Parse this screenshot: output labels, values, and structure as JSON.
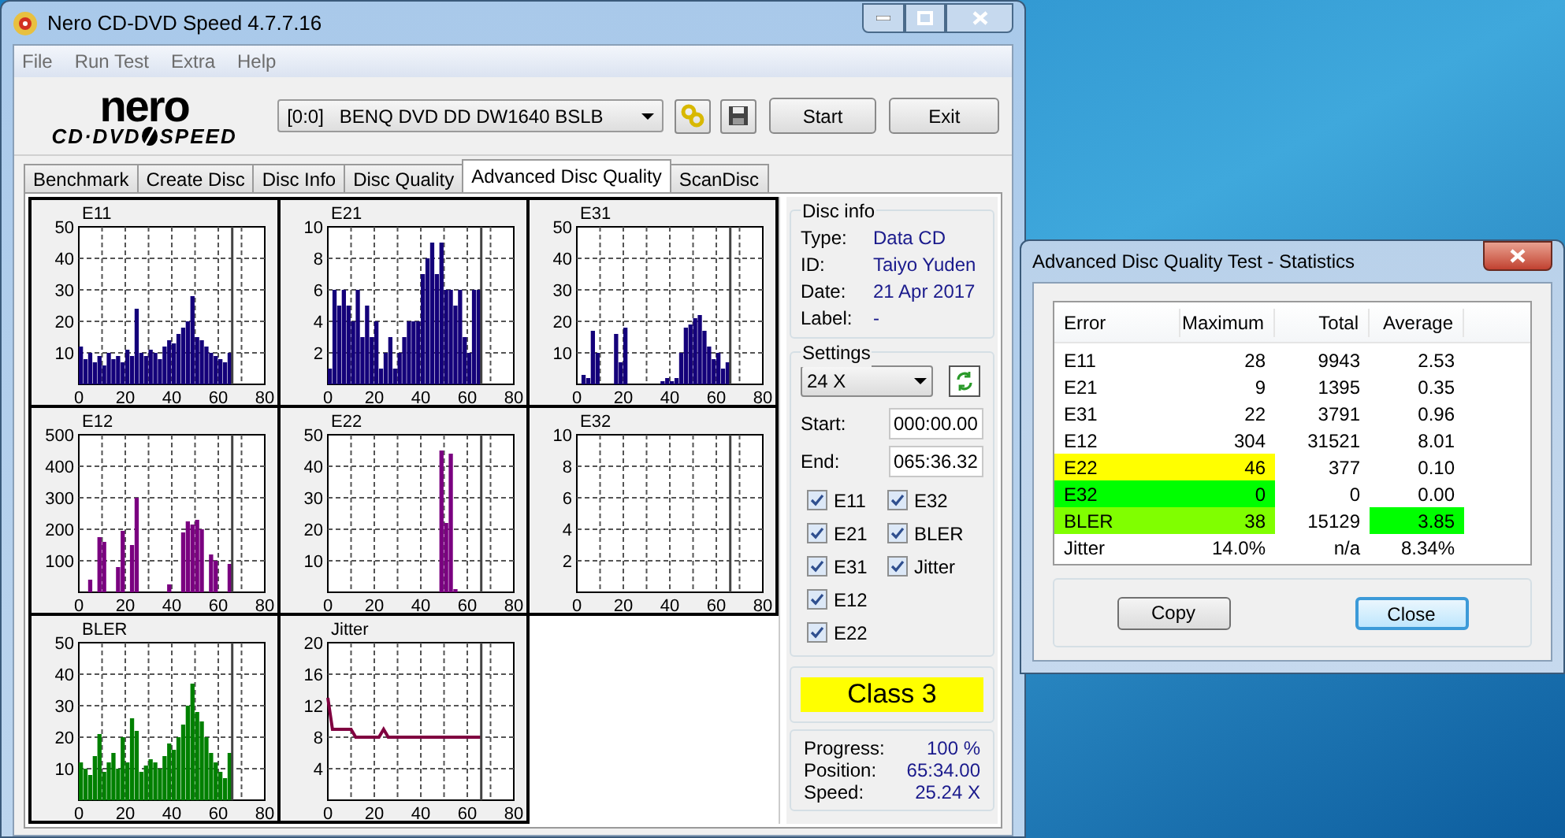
{
  "window": {
    "title": "Nero CD-DVD Speed 4.7.7.16"
  },
  "menu": [
    "File",
    "Run Test",
    "Extra",
    "Help"
  ],
  "logo": {
    "brand": "nero",
    "line_left": "CD·DVD",
    "line_right": "SPEED"
  },
  "toolbar": {
    "drive": "[0:0]   BENQ DVD DD DW1640 BSLB",
    "start": "Start",
    "exit": "Exit"
  },
  "tabs": [
    {
      "label": "Benchmark",
      "selected": false
    },
    {
      "label": "Create Disc",
      "selected": false
    },
    {
      "label": "Disc Info",
      "selected": false
    },
    {
      "label": "Disc Quality",
      "selected": false
    },
    {
      "label": "Advanced Disc Quality",
      "selected": true
    },
    {
      "label": "ScanDisc",
      "selected": false
    }
  ],
  "charts": [
    {
      "chart_data": {
        "type": "bar",
        "title": "E11",
        "x": [
          0,
          2,
          4,
          6,
          8,
          10,
          12,
          14,
          16,
          18,
          20,
          22,
          24,
          26,
          28,
          30,
          32,
          34,
          36,
          38,
          40,
          42,
          44,
          46,
          48,
          50,
          52,
          54,
          56,
          58,
          60,
          62,
          64
        ],
        "grid": true,
        "series": [
          {
            "color": "#14007a",
            "values": [
              12,
              8,
              10,
              7,
              9,
              6,
              10,
              8,
              9,
              7,
              11,
              9,
              24,
              10,
              9,
              11,
              10,
              8,
              12,
              14,
              13,
              16,
              18,
              20,
              28,
              15,
              14,
              12,
              10,
              9,
              8,
              7,
              10
            ]
          }
        ],
        "xlim": [
          0,
          80
        ],
        "ylim": [
          0,
          50
        ],
        "xticks": [
          0,
          20,
          40,
          60,
          80
        ],
        "yticks": [
          10,
          20,
          30,
          40,
          50
        ],
        "ref_lines": [
          {
            "axis": "x",
            "value": 66
          }
        ]
      }
    },
    {
      "chart_data": {
        "type": "bar",
        "title": "E21",
        "x": [
          0,
          2,
          4,
          6,
          8,
          10,
          12,
          14,
          16,
          18,
          20,
          22,
          24,
          26,
          28,
          30,
          32,
          34,
          36,
          38,
          40,
          42,
          44,
          46,
          48,
          50,
          52,
          54,
          56,
          58,
          60,
          62,
          64
        ],
        "grid": true,
        "series": [
          {
            "color": "#14007a",
            "values": [
              1,
              6,
              5,
              6,
              5,
              4,
              6,
              3,
              5,
              3,
              4,
              1,
              2,
              3,
              1,
              2,
              3,
              4,
              4,
              4,
              7,
              8,
              9,
              7,
              9,
              6,
              6,
              5,
              6,
              3,
              2,
              6,
              6
            ]
          }
        ],
        "xlim": [
          0,
          80
        ],
        "ylim": [
          0,
          10
        ],
        "xticks": [
          0,
          20,
          40,
          60,
          80
        ],
        "yticks": [
          2,
          4,
          6,
          8,
          10
        ],
        "ref_lines": [
          {
            "axis": "x",
            "value": 66
          }
        ]
      }
    },
    {
      "chart_data": {
        "type": "bar",
        "title": "E31",
        "x": [
          0,
          2,
          4,
          6,
          8,
          10,
          12,
          14,
          16,
          18,
          20,
          22,
          24,
          26,
          28,
          30,
          32,
          34,
          36,
          38,
          40,
          42,
          44,
          46,
          48,
          50,
          52,
          54,
          56,
          58,
          60,
          62,
          64
        ],
        "grid": true,
        "series": [
          {
            "color": "#14007a",
            "values": [
              0,
              3,
              2,
              17,
              10,
              0,
              0,
              0,
              16,
              7,
              18,
              0,
              0,
              0,
              0,
              0,
              0,
              0,
              1,
              2,
              1,
              2,
              10,
              18,
              19,
              21,
              22,
              17,
              12,
              8,
              10,
              5,
              7
            ]
          }
        ],
        "xlim": [
          0,
          80
        ],
        "ylim": [
          0,
          50
        ],
        "xticks": [
          0,
          20,
          40,
          60,
          80
        ],
        "yticks": [
          10,
          20,
          30,
          40,
          50
        ],
        "ref_lines": [
          {
            "axis": "x",
            "value": 66
          }
        ]
      }
    },
    {
      "chart_data": {
        "type": "bar",
        "title": "E12",
        "x": [
          0,
          2,
          4,
          6,
          8,
          10,
          12,
          14,
          16,
          18,
          20,
          22,
          24,
          26,
          28,
          30,
          32,
          34,
          36,
          38,
          40,
          42,
          44,
          46,
          48,
          50,
          52,
          54,
          56,
          58,
          60,
          62,
          64
        ],
        "grid": true,
        "series": [
          {
            "color": "#7a0080",
            "values": [
              0,
              0,
              40,
              0,
              175,
              160,
              0,
              0,
              80,
              195,
              0,
              150,
              300,
              0,
              0,
              0,
              0,
              0,
              0,
              25,
              0,
              0,
              190,
              225,
              215,
              230,
              200,
              0,
              120,
              100,
              0,
              0,
              90
            ]
          }
        ],
        "xlim": [
          0,
          80
        ],
        "ylim": [
          0,
          500
        ],
        "xticks": [
          0,
          20,
          40,
          60,
          80
        ],
        "yticks": [
          100,
          200,
          300,
          400,
          500
        ],
        "ref_lines": [
          {
            "axis": "x",
            "value": 66
          }
        ]
      }
    },
    {
      "chart_data": {
        "type": "bar",
        "title": "E22",
        "x": [
          0,
          2,
          4,
          6,
          8,
          10,
          12,
          14,
          16,
          18,
          20,
          22,
          24,
          26,
          28,
          30,
          32,
          34,
          36,
          38,
          40,
          42,
          44,
          46,
          48,
          50,
          52,
          54,
          56,
          58,
          60,
          62,
          64
        ],
        "grid": true,
        "series": [
          {
            "color": "#7a0080",
            "values": [
              0,
              0,
              0,
              0,
              0,
              0,
              0,
              0,
              0,
              0,
              0,
              0,
              0,
              0,
              0,
              0,
              0,
              0,
              0,
              0,
              0,
              0,
              0,
              0,
              45,
              22,
              44,
              1,
              0,
              0,
              0,
              0,
              0
            ]
          }
        ],
        "xlim": [
          0,
          80
        ],
        "ylim": [
          0,
          50
        ],
        "xticks": [
          0,
          20,
          40,
          60,
          80
        ],
        "yticks": [
          10,
          20,
          30,
          40,
          50
        ],
        "ref_lines": [
          {
            "axis": "x",
            "value": 66
          }
        ]
      }
    },
    {
      "chart_data": {
        "type": "bar",
        "title": "E32",
        "x": [
          0,
          2,
          4,
          6,
          8,
          10,
          12,
          14,
          16,
          18,
          20,
          22,
          24,
          26,
          28,
          30,
          32,
          34,
          36,
          38,
          40,
          42,
          44,
          46,
          48,
          50,
          52,
          54,
          56,
          58,
          60,
          62,
          64
        ],
        "grid": true,
        "series": [
          {
            "values": [
              0,
              0,
              0,
              0,
              0,
              0,
              0,
              0,
              0,
              0,
              0,
              0,
              0,
              0,
              0,
              0,
              0,
              0,
              0,
              0,
              0,
              0,
              0,
              0,
              0,
              0,
              0,
              0,
              0,
              0,
              0,
              0,
              0
            ]
          }
        ],
        "xlim": [
          0,
          80
        ],
        "ylim": [
          0,
          10
        ],
        "xticks": [
          0,
          20,
          40,
          60,
          80
        ],
        "yticks": [
          2,
          4,
          6,
          8,
          10
        ],
        "ref_lines": [
          {
            "axis": "x",
            "value": 66
          }
        ]
      }
    },
    {
      "chart_data": {
        "type": "bar",
        "title": "BLER",
        "x": [
          0,
          2,
          4,
          6,
          8,
          10,
          12,
          14,
          16,
          18,
          20,
          22,
          24,
          26,
          28,
          30,
          32,
          34,
          36,
          38,
          40,
          42,
          44,
          46,
          48,
          50,
          52,
          54,
          56,
          58,
          60,
          62,
          64
        ],
        "grid": true,
        "series": [
          {
            "color": "#008000",
            "values": [
              12,
              10,
              8,
              14,
              21,
              9,
              12,
              15,
              10,
              20,
              12,
              26,
              22,
              9,
              11,
              13,
              12,
              10,
              14,
              18,
              16,
              20,
              24,
              30,
              37,
              28,
              25,
              20,
              15,
              12,
              9,
              7,
              15
            ]
          }
        ],
        "xlim": [
          0,
          80
        ],
        "ylim": [
          0,
          50
        ],
        "xticks": [
          0,
          20,
          40,
          60,
          80
        ],
        "yticks": [
          10,
          20,
          30,
          40,
          50
        ],
        "ref_lines": [
          {
            "axis": "x",
            "value": 66
          }
        ]
      }
    },
    {
      "chart_data": {
        "type": "line",
        "title": "Jitter",
        "x": [
          0,
          2,
          4,
          6,
          8,
          10,
          12,
          14,
          16,
          18,
          20,
          22,
          24,
          26,
          28,
          30,
          32,
          34,
          36,
          38,
          40,
          42,
          44,
          46,
          48,
          50,
          52,
          54,
          56,
          58,
          60,
          62,
          64,
          66
        ],
        "grid": true,
        "series": [
          {
            "color": "#800040",
            "values": [
              13,
              9,
              9,
              9,
              9,
              9,
              8,
              8,
              8,
              8,
              8,
              8,
              9,
              8,
              8,
              8,
              8,
              8,
              8,
              8,
              8,
              8,
              8,
              8,
              8,
              8,
              8,
              8,
              8,
              8,
              8,
              8,
              8,
              8
            ]
          }
        ],
        "xlim": [
          0,
          80
        ],
        "ylim": [
          0,
          20
        ],
        "xticks": [
          0,
          20,
          40,
          60,
          80
        ],
        "yticks": [
          4,
          8,
          12,
          16,
          20
        ],
        "ref_lines": [
          {
            "axis": "x",
            "value": 66
          }
        ]
      }
    }
  ],
  "disc_info": {
    "title": "Disc info",
    "fields": [
      {
        "label": "Type:",
        "value": "Data CD"
      },
      {
        "label": "ID:",
        "value": "Taiyo Yuden"
      },
      {
        "label": "Date:",
        "value": "21 Apr 2017"
      },
      {
        "label": "Label:",
        "value": "-"
      }
    ]
  },
  "settings": {
    "title": "Settings",
    "speed": "24 X",
    "start_label": "Start:",
    "start": "000:00.00",
    "end_label": "End:",
    "end": "065:36.32",
    "checks": [
      {
        "label": "E11",
        "checked": true
      },
      {
        "label": "E21",
        "checked": true
      },
      {
        "label": "E31",
        "checked": true
      },
      {
        "label": "E12",
        "checked": true
      },
      {
        "label": "E22",
        "checked": true
      },
      {
        "label": "E32",
        "checked": true
      },
      {
        "label": "BLER",
        "checked": true
      },
      {
        "label": "Jitter",
        "checked": true
      }
    ]
  },
  "grade": "Class 3",
  "progress": [
    {
      "label": "Progress:",
      "value": "100 %"
    },
    {
      "label": "Position:",
      "value": "65:34.00"
    },
    {
      "label": "Speed:",
      "value": "25.24 X"
    }
  ],
  "dialog": {
    "title": "Advanced Disc Quality Test - Statistics",
    "columns": [
      "Error",
      "Maximum",
      "Total",
      "Average"
    ],
    "rows": [
      {
        "error": "E11",
        "maximum": "28",
        "total": "9943",
        "average": {
          "text": "2.53"
        }
      },
      {
        "error": "E21",
        "maximum": "9",
        "total": "1395",
        "average": {
          "text": "0.35"
        }
      },
      {
        "error": "E31",
        "maximum": "22",
        "total": "3791",
        "average": {
          "text": "0.96"
        }
      },
      {
        "error": "E12",
        "maximum": "304",
        "total": "31521",
        "average": {
          "text": "8.01"
        }
      },
      {
        "error": "E22",
        "maximum": "46",
        "total": "377",
        "average": {
          "text": "0.10"
        },
        "color": "#ffff00"
      },
      {
        "error": "E32",
        "maximum": "0",
        "total": "0",
        "average": {
          "text": "0.00"
        },
        "color": "#00ff00"
      },
      {
        "error": "BLER",
        "maximum": "38",
        "total": "15129",
        "average": {
          "text": "3.85",
          "color": "#00ff00"
        },
        "color": "#80ff00"
      },
      {
        "error": "Jitter",
        "maximum": "14.0%",
        "total": "n/a",
        "average": {
          "text": "8.34%"
        }
      }
    ],
    "buttons": [
      "Copy",
      "Close"
    ]
  }
}
